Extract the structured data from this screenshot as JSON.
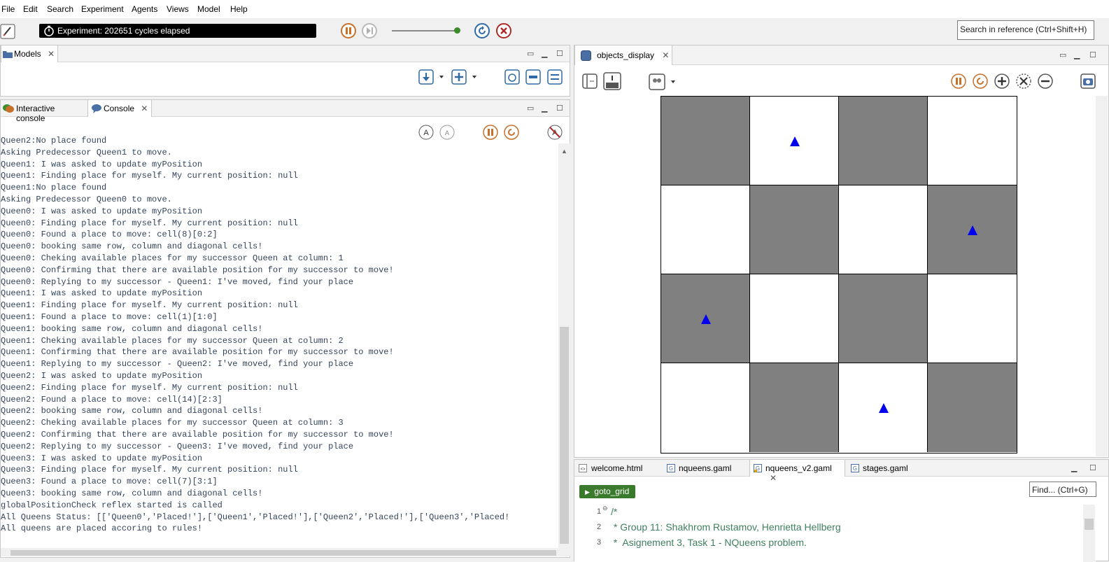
{
  "menu": [
    "File",
    "Edit",
    "Search",
    "Experiment",
    "Agents",
    "Views",
    "Model",
    "Help"
  ],
  "toolbar": {
    "status_text": "Experiment: 202651 cycles elapsed",
    "search_placeholder": "Search in reference (Ctrl+Shift+H)"
  },
  "models_panel": {
    "tab": "Models"
  },
  "console_panel": {
    "tabs": [
      "Interactive console",
      "Console"
    ],
    "lines": [
      "Queen2:No place found",
      "Asking Predecessor Queen1 to move.",
      "Queen1: I was asked to update myPosition",
      "Queen1: Finding place for myself. My current position: null",
      "Queen1:No place found",
      "Asking Predecessor Queen0 to move.",
      "Queen0: I was asked to update myPosition",
      "Queen0: Finding place for myself. My current position: null",
      "Queen0: Found a place to move: cell(8)[0:2]",
      "Queen0: booking same row, column and diagonal cells!",
      "Queen0: Cheking available places for my successor Queen at column: 1",
      "Queen0: Confirming that there are available position for my successor to move!",
      "Queen0: Replying to my successor - Queen1: I've moved, find your place",
      "Queen1: I was asked to update myPosition",
      "Queen1: Finding place for myself. My current position: null",
      "Queen1: Found a place to move: cell(1)[1:0]",
      "Queen1: booking same row, column and diagonal cells!",
      "Queen1: Cheking available places for my successor Queen at column: 2",
      "Queen1: Confirming that there are available position for my successor to move!",
      "Queen1: Replying to my successor - Queen2: I've moved, find your place",
      "Queen2: I was asked to update myPosition",
      "Queen2: Finding place for myself. My current position: null",
      "Queen2: Found a place to move: cell(14)[2:3]",
      "Queen2: booking same row, column and diagonal cells!",
      "Queen2: Cheking available places for my successor Queen at column: 3",
      "Queen2: Confirming that there are available position for my successor to move!",
      "Queen2: Replying to my successor - Queen3: I've moved, find your place",
      "Queen3: I was asked to update myPosition",
      "Queen3: Finding place for myself. My current position: null",
      "Queen3: Found a place to move: cell(7)[3:1]",
      "Queen3: booking same row, column and diagonal cells!",
      "globalPositionCheck reflex started is called",
      "All Queens Status: [['Queen0','Placed!'],['Queen1','Placed!'],['Queen2','Placed!'],['Queen3','Placed!",
      "All queens are placed accoring to rules!"
    ]
  },
  "display_panel": {
    "tab": "objects_display",
    "board": {
      "size": 4,
      "colors": {
        "dark": "#808080",
        "light": "#ffffff",
        "queen": "#0000ee"
      },
      "dark_cells": [
        [
          0,
          0
        ],
        [
          0,
          2
        ],
        [
          1,
          1
        ],
        [
          1,
          3
        ],
        [
          2,
          0
        ],
        [
          2,
          2
        ],
        [
          3,
          1
        ],
        [
          3,
          3
        ]
      ],
      "queens": [
        [
          0,
          1
        ],
        [
          1,
          3
        ],
        [
          2,
          0
        ],
        [
          3,
          2
        ]
      ]
    }
  },
  "editor_panel": {
    "tabs": [
      "welcome.html",
      "nqueens.gaml",
      "nqueens_v2.gaml",
      "stages.gaml"
    ],
    "goto_label": "goto_grid",
    "find_placeholder": "Find... (Ctrl+G)",
    "line_numbers": [
      "1",
      "2",
      "3"
    ],
    "code_lines": [
      "/*",
      " * Group 11: Shakhrom Rustamov, Henrietta Hellberg",
      " *  Asignement 3, Task 1 - NQueens problem."
    ]
  }
}
